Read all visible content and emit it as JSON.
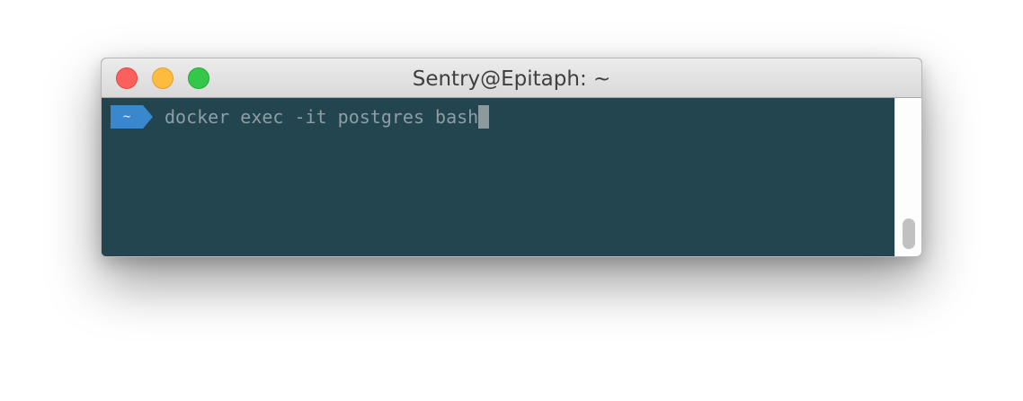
{
  "window": {
    "title": "Sentry@Epitaph: ~"
  },
  "terminal": {
    "prompt_dir": "~",
    "command": "docker exec -it postgres bash",
    "background_color": "#234550",
    "prompt_color": "#3987cd"
  },
  "icons": {
    "close": "close-circle-icon",
    "minimize": "minimize-circle-icon",
    "maximize": "maximize-circle-icon",
    "prompt_arrow": "chevron-right-icon"
  }
}
